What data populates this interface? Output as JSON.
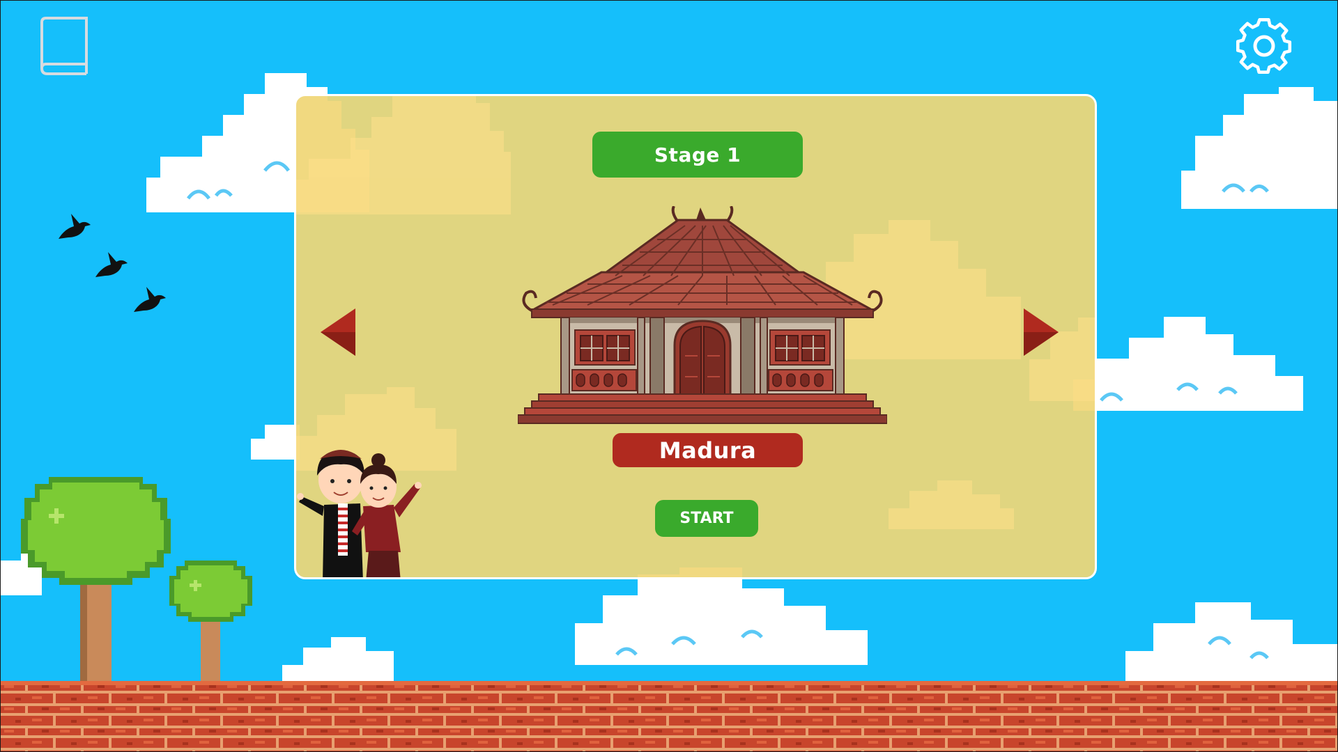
{
  "stage": {
    "label": "Stage 1"
  },
  "region": {
    "name": "Madura"
  },
  "actions": {
    "start_label": "START"
  },
  "icons": {
    "book": "book-icon",
    "settings": "gear-icon",
    "prev": "triangle-left-icon",
    "next": "triangle-right-icon"
  },
  "colors": {
    "sky": "#15bffb",
    "panel": "#f0d676",
    "stage_badge": "#3aaa2c",
    "name_badge": "#b02a1f",
    "start_button": "#3aaa2c",
    "arrow": "#b02a1f",
    "brick": "#c8452c"
  }
}
